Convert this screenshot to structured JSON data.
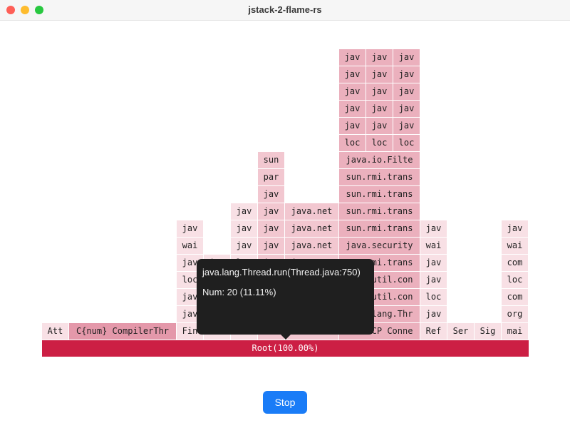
{
  "window": {
    "title": "jstack-2-flame-rs"
  },
  "flamegraph": {
    "root": {
      "label": "Root(100.00%)",
      "color": "#cc1f44"
    },
    "palette": [
      "#f8e0e5",
      "#f2c7d0",
      "#ebb0bd",
      "#e498aa"
    ],
    "frames": [
      {
        "label": "Att",
        "c": 0
      },
      {
        "label": "C{num} CompilerThr",
        "c": 3
      },
      {
        "label": "Fin",
        "c": 0
      },
      {
        "label": "GC",
        "c": 0
      },
      {
        "label": "RMI",
        "c": 0
      },
      {
        "label": "RMI",
        "c": 1
      },
      {
        "label": "RMI TCP",
        "c": 1
      },
      {
        "label": "RMI TCP Conne",
        "c": 2
      },
      {
        "label": "Ref",
        "c": 0
      },
      {
        "label": "Ser",
        "c": 0
      },
      {
        "label": "Sig",
        "c": 0
      },
      {
        "label": "mai",
        "c": 0
      },
      {
        "label": "jav",
        "c": 0
      },
      {
        "label": "loc",
        "c": 0
      },
      {
        "label": "jav",
        "c": 0
      },
      {
        "label": "jav",
        "c": 1
      },
      {
        "label": "java.lan",
        "c": 1
      },
      {
        "label": "java.lang.Thr",
        "c": 2
      },
      {
        "label": "jav",
        "c": 0
      },
      {
        "label": "org",
        "c": 0
      },
      {
        "label": "jav",
        "c": 0
      },
      {
        "label": "sun",
        "c": 0
      },
      {
        "label": "sun",
        "c": 0
      },
      {
        "label": "jav",
        "c": 1
      },
      {
        "label": "sun.rmi.",
        "c": 1
      },
      {
        "label": "java.util.con",
        "c": 2
      },
      {
        "label": "loc",
        "c": 0
      },
      {
        "label": "com",
        "c": 0
      },
      {
        "label": "loc",
        "c": 0
      },
      {
        "label": "wai",
        "c": 0
      },
      {
        "label": "jav",
        "c": 0
      },
      {
        "label": "jav",
        "c": 1
      },
      {
        "label": "sun.rmi.",
        "c": 1
      },
      {
        "label": "java.util.con",
        "c": 2
      },
      {
        "label": "jav",
        "c": 0
      },
      {
        "label": "loc",
        "c": 0
      },
      {
        "label": "jav",
        "c": 0
      },
      {
        "label": "jav",
        "c": 0
      },
      {
        "label": "loc",
        "c": 0
      },
      {
        "label": "jav",
        "c": 1
      },
      {
        "label": "java.net",
        "c": 1
      },
      {
        "label": "sun.rmi.trans",
        "c": 2
      },
      {
        "label": "jav",
        "c": 0
      },
      {
        "label": "com",
        "c": 0
      },
      {
        "label": "wai",
        "c": 0
      },
      {
        "label": "jav",
        "c": 0
      },
      {
        "label": "jav",
        "c": 1
      },
      {
        "label": "java.net",
        "c": 1
      },
      {
        "label": "java.security",
        "c": 2
      },
      {
        "label": "wai",
        "c": 0
      },
      {
        "label": "wai",
        "c": 0
      },
      {
        "label": "jav",
        "c": 0
      },
      {
        "label": "jav",
        "c": 0
      },
      {
        "label": "jav",
        "c": 1
      },
      {
        "label": "java.net",
        "c": 1
      },
      {
        "label": "sun.rmi.trans",
        "c": 2
      },
      {
        "label": "jav",
        "c": 0
      },
      {
        "label": "jav",
        "c": 0
      },
      {
        "label": "jav",
        "c": 0
      },
      {
        "label": "jav",
        "c": 1
      },
      {
        "label": "java.net",
        "c": 1
      },
      {
        "label": "sun.rmi.trans",
        "c": 2
      },
      {
        "label": "jav",
        "c": 1
      },
      {
        "label": "sun.rmi.trans",
        "c": 2
      },
      {
        "label": "par",
        "c": 1
      },
      {
        "label": "sun.rmi.trans",
        "c": 2
      },
      {
        "label": "sun",
        "c": 1
      },
      {
        "label": "java.io.Filte",
        "c": 2
      },
      {
        "label": "loc",
        "c": 2
      },
      {
        "label": "loc",
        "c": 2
      },
      {
        "label": "loc",
        "c": 2
      },
      {
        "label": "jav",
        "c": 2
      },
      {
        "label": "jav",
        "c": 2
      },
      {
        "label": "jav",
        "c": 2
      },
      {
        "label": "jav",
        "c": 2
      },
      {
        "label": "jav",
        "c": 2
      },
      {
        "label": "jav",
        "c": 2
      },
      {
        "label": "jav",
        "c": 2
      },
      {
        "label": "jav",
        "c": 2
      },
      {
        "label": "jav",
        "c": 2
      },
      {
        "label": "jav",
        "c": 2
      },
      {
        "label": "jav",
        "c": 2
      },
      {
        "label": "jav",
        "c": 2
      },
      {
        "label": "jav",
        "c": 2
      },
      {
        "label": "jav",
        "c": 2
      },
      {
        "label": "jav",
        "c": 2
      }
    ]
  },
  "tooltip": {
    "title": "java.lang.Thread.run(Thread.java:750)",
    "num": "Num: 20 (11.11%)"
  },
  "controls": {
    "stop_label": "Stop"
  }
}
